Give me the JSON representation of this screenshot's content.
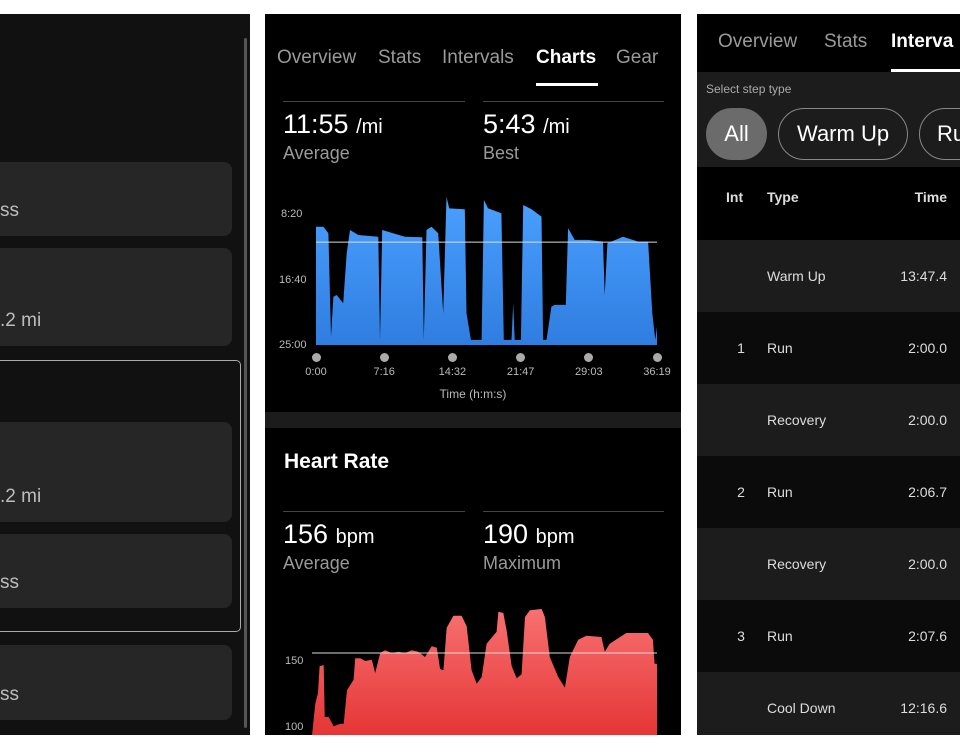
{
  "left_panel": {
    "cards": [
      {
        "text": "ss"
      },
      {
        "text": ".2 mi"
      },
      {
        "text": ".2 mi"
      },
      {
        "text": "ss"
      },
      {
        "text": "ss"
      }
    ]
  },
  "middle_panel": {
    "tabs": [
      "Overview",
      "Stats",
      "Intervals",
      "Charts",
      "Gear"
    ],
    "active_tab": "Charts",
    "pace": {
      "average_value": "11:55",
      "average_unit": "/mi",
      "average_label": "Average",
      "best_value": "5:43",
      "best_unit": "/mi",
      "best_label": "Best"
    },
    "heart_rate": {
      "title": "Heart Rate",
      "average_value": "156",
      "average_unit": "bpm",
      "average_label": "Average",
      "max_value": "190",
      "max_unit": "bpm",
      "max_label": "Maximum"
    }
  },
  "right_panel": {
    "tabs": [
      "Overview",
      "Stats",
      "Interva"
    ],
    "active_tab": "Interva",
    "filter_label": "Select step type",
    "pills": [
      {
        "label": "All",
        "selected": true
      },
      {
        "label": "Warm Up",
        "selected": false
      },
      {
        "label": "Ru",
        "selected": false
      }
    ],
    "columns": [
      "Int",
      "Type",
      "Time"
    ],
    "rows": [
      {
        "int": "",
        "type": "Warm Up",
        "time": "13:47.4"
      },
      {
        "int": "1",
        "type": "Run",
        "time": "2:00.0"
      },
      {
        "int": "",
        "type": "Recovery",
        "time": "2:00.0"
      },
      {
        "int": "2",
        "type": "Run",
        "time": "2:06.7"
      },
      {
        "int": "",
        "type": "Recovery",
        "time": "2:00.0"
      },
      {
        "int": "3",
        "type": "Run",
        "time": "2:07.6"
      },
      {
        "int": "",
        "type": "Cool Down",
        "time": "12:16.6"
      }
    ]
  },
  "chart_data": [
    {
      "type": "area",
      "xlabel": "Time (h:m:s)",
      "ylabel": "",
      "x_ticks": [
        "0:00",
        "7:16",
        "14:32",
        "21:47",
        "29:03",
        "36:19"
      ],
      "y_ticks": [
        "8:20",
        "16:40",
        "25:00"
      ],
      "y_inverted": true,
      "ylim": [
        "25:00",
        "8:20"
      ],
      "reference_line": "11:55",
      "color": "#3d8ef0",
      "points": [
        [
          "0:00",
          "9:57"
        ],
        [
          "0:47",
          "9:57"
        ],
        [
          "1:19",
          "10:47"
        ],
        [
          "1:36",
          "23:56"
        ],
        [
          "1:51",
          "18:51"
        ],
        [
          "2:12",
          "18:38"
        ],
        [
          "2:54",
          "19:42"
        ],
        [
          "3:16",
          "13:20"
        ],
        [
          "3:37",
          "10:22"
        ],
        [
          "4:30",
          "11:00"
        ],
        [
          "6:38",
          "11:13"
        ],
        [
          "6:49",
          "24:21"
        ],
        [
          "7:03",
          "10:22"
        ],
        [
          "9:28",
          "11:13"
        ],
        [
          "11:19",
          "11:18"
        ],
        [
          "11:29",
          "24:21"
        ],
        [
          "11:46",
          "10:22"
        ],
        [
          "12:18",
          "9:57"
        ],
        [
          "13:01",
          "10:47"
        ],
        [
          "13:33",
          "20:58"
        ],
        [
          "13:54",
          "6:08"
        ],
        [
          "14:11",
          "7:37"
        ],
        [
          "15:51",
          "7:44"
        ],
        [
          "16:02",
          "20:58"
        ],
        [
          "16:30",
          "24:21"
        ],
        [
          "17:38",
          "24:21"
        ],
        [
          "17:53",
          "6:33"
        ],
        [
          "18:20",
          "7:37"
        ],
        [
          "19:45",
          "8:15"
        ],
        [
          "20:00",
          "24:21"
        ],
        [
          "20:49",
          "24:21"
        ],
        [
          "21:00",
          "19:42"
        ],
        [
          "21:10",
          "24:21"
        ],
        [
          "21:49",
          "24:21"
        ],
        [
          "22:04",
          "7:11"
        ],
        [
          "22:57",
          "7:44"
        ],
        [
          "24:01",
          "8:40"
        ],
        [
          "24:11",
          "24:21"
        ],
        [
          "24:33",
          "24:21"
        ],
        [
          "25:04",
          "20:07"
        ],
        [
          "25:26",
          "19:54"
        ],
        [
          "26:36",
          "19:54"
        ],
        [
          "26:51",
          "10:09"
        ],
        [
          "27:33",
          "11:38"
        ],
        [
          "28:59",
          "11:38"
        ],
        [
          "30:34",
          "11:51"
        ],
        [
          "30:45",
          "18:38"
        ],
        [
          "31:02",
          "12:04"
        ],
        [
          "32:42",
          "11:13"
        ],
        [
          "34:18",
          "11:51"
        ],
        [
          "35:22",
          "11:51"
        ],
        [
          "35:49",
          "20:58"
        ],
        [
          "36:08",
          "24:21"
        ],
        [
          "36:19",
          "22:40"
        ]
      ]
    },
    {
      "type": "area",
      "title": "Heart Rate",
      "xlabel": "",
      "ylabel": "",
      "y_ticks": [
        "150",
        "100"
      ],
      "reference_line": 156,
      "color": "#ef4444",
      "points": [
        [
          "0:00",
          94
        ],
        [
          "0:21",
          118
        ],
        [
          "0:38",
          126
        ],
        [
          "0:48",
          146
        ],
        [
          "1:14",
          147
        ],
        [
          "1:20",
          108
        ],
        [
          "1:45",
          108
        ],
        [
          "2:17",
          101
        ],
        [
          "2:59",
          103
        ],
        [
          "3:20",
          103
        ],
        [
          "3:41",
          128
        ],
        [
          "4:23",
          136
        ],
        [
          "4:33",
          152
        ],
        [
          "5:05",
          152
        ],
        [
          "5:36",
          150
        ],
        [
          "6:18",
          151
        ],
        [
          "6:39",
          141
        ],
        [
          "7:11",
          156
        ],
        [
          "7:42",
          158
        ],
        [
          "8:24",
          156
        ],
        [
          "9:06",
          157
        ],
        [
          "9:48",
          156
        ],
        [
          "10:30",
          158
        ],
        [
          "11:12",
          157
        ],
        [
          "11:54",
          153
        ],
        [
          "12:36",
          161
        ],
        [
          "13:08",
          160
        ],
        [
          "13:29",
          144
        ],
        [
          "13:50",
          143
        ],
        [
          "14:11",
          175
        ],
        [
          "14:53",
          184
        ],
        [
          "15:45",
          184
        ],
        [
          "16:17",
          176
        ],
        [
          "16:48",
          143
        ],
        [
          "17:20",
          133
        ],
        [
          "17:52",
          138
        ],
        [
          "18:23",
          163
        ],
        [
          "19:26",
          172
        ],
        [
          "19:37",
          187
        ],
        [
          "20:08",
          186
        ],
        [
          "20:29",
          173
        ],
        [
          "21:01",
          146
        ],
        [
          "21:32",
          137
        ],
        [
          "22:04",
          140
        ],
        [
          "22:25",
          183
        ],
        [
          "22:56",
          188
        ],
        [
          "24:10",
          189
        ],
        [
          "24:31",
          183
        ],
        [
          "25:02",
          153
        ],
        [
          "25:55",
          138
        ],
        [
          "26:37",
          130
        ],
        [
          "27:08",
          153
        ],
        [
          "28:01",
          166
        ],
        [
          "28:53",
          169
        ],
        [
          "30:28",
          168
        ],
        [
          "30:49",
          157
        ],
        [
          "31:20",
          163
        ],
        [
          "33:05",
          171
        ],
        [
          "35:22",
          171
        ],
        [
          "35:53",
          166
        ],
        [
          "36:04",
          148
        ],
        [
          "36:19",
          148
        ]
      ]
    }
  ]
}
